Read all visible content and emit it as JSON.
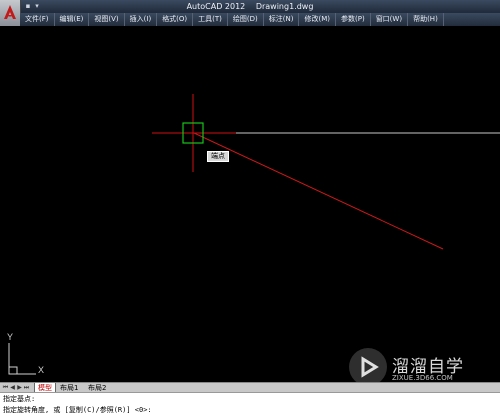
{
  "window": {
    "app_title": "AutoCAD 2012",
    "document_title": "Drawing1.dwg"
  },
  "menu": {
    "items": [
      {
        "label": "文件(F)"
      },
      {
        "label": "编辑(E)"
      },
      {
        "label": "视图(V)"
      },
      {
        "label": "插入(I)"
      },
      {
        "label": "格式(O)"
      },
      {
        "label": "工具(T)"
      },
      {
        "label": "绘图(D)"
      },
      {
        "label": "标注(N)"
      },
      {
        "label": "修改(M)"
      },
      {
        "label": "参数(P)"
      },
      {
        "label": "窗口(W)"
      },
      {
        "label": "帮助(H)"
      }
    ]
  },
  "canvas": {
    "snap_tooltip": "端点"
  },
  "layout_tabs": {
    "tabs": [
      {
        "label": "模型"
      },
      {
        "label": "布局1"
      },
      {
        "label": "布局2"
      }
    ]
  },
  "command_line": {
    "history": "指定基点:",
    "prompt": "指定旋转角度, 或 [复制(C)/参照(R)] <0>:"
  },
  "watermark": {
    "name": "溜溜自学",
    "url": "ZIXUE.3D66.COM"
  },
  "colors": {
    "background": "#000000",
    "crosshair": "#d01010",
    "snap_marker": "#19c419",
    "line_white": "#c8c8c8",
    "line_red": "#cc1818"
  }
}
